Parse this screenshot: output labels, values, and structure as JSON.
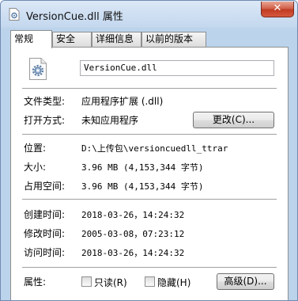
{
  "window": {
    "title": "VersionCue.dll 属性",
    "close_glyph": "✕"
  },
  "tabs": [
    {
      "label": "常规"
    },
    {
      "label": "安全"
    },
    {
      "label": "详细信息"
    },
    {
      "label": "以前的版本"
    }
  ],
  "general": {
    "filename": "VersionCue.dll",
    "file_type_label": "文件类型:",
    "file_type_value": "应用程序扩展 (.dll)",
    "opens_with_label": "打开方式:",
    "opens_with_value": "未知应用程序",
    "change_button": "更改(C)...",
    "location_label": "位置:",
    "location_value": "D:\\上传包\\versioncuedll_ttrar",
    "size_label": "大小:",
    "size_value": "3.96 MB (4,153,344 字节)",
    "size_on_disk_label": "占用空间:",
    "size_on_disk_value": "3.96 MB (4,153,344 字节)",
    "created_label": "创建时间:",
    "created_value": "2018-03-26，14:24:32",
    "modified_label": "修改时间:",
    "modified_value": "2005-03-08，07:23:12",
    "accessed_label": "访问时间:",
    "accessed_value": "2018-03-26，14:24:32",
    "attributes_label": "属性:",
    "readonly_label": "只读(R)",
    "readonly_checked": false,
    "hidden_label": "隐藏(H)",
    "hidden_checked": false,
    "advanced_button": "高级(D)..."
  },
  "icons": {
    "title_icon": "dll-file-icon",
    "file_icon": "dll-gear-file-icon"
  },
  "colors": {
    "window_frame": "#bcd3ec",
    "close_button": "#c9452d",
    "panel_background": "#ffffff"
  }
}
